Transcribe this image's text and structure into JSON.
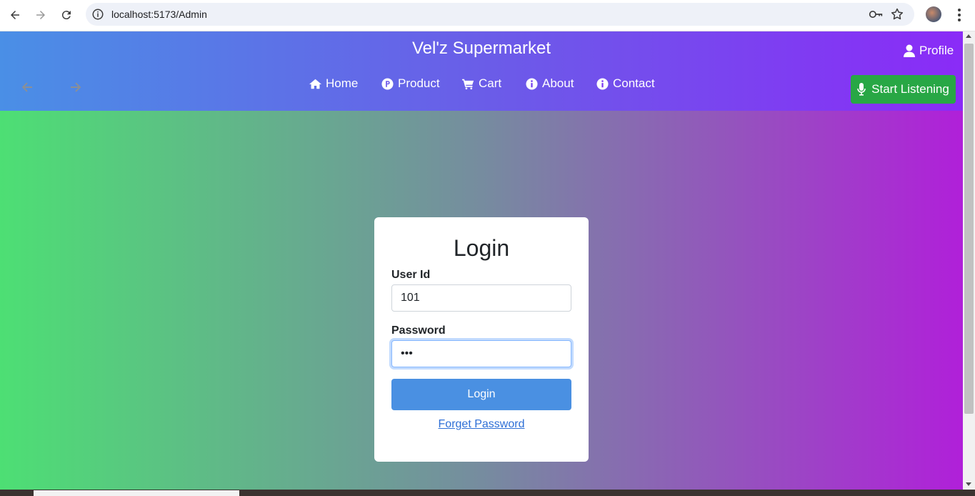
{
  "browser": {
    "url": "localhost:5173/Admin"
  },
  "header": {
    "site_title": "Vel'z Supermarket",
    "profile_label": "Profile",
    "listen_label": "Start Listening",
    "nav": [
      {
        "label": "Home",
        "icon": "home-icon"
      },
      {
        "label": "Product",
        "icon": "product-icon"
      },
      {
        "label": "Cart",
        "icon": "cart-icon"
      },
      {
        "label": "About",
        "icon": "info-icon"
      },
      {
        "label": "Contact",
        "icon": "info-icon"
      }
    ]
  },
  "login": {
    "title": "Login",
    "user_id_label": "User Id",
    "user_id_value": "101",
    "password_label": "Password",
    "password_value": "•••",
    "submit_label": "Login",
    "forgot_label": "Forget Password"
  },
  "colors": {
    "header_gradient": [
      "#4a8fe6",
      "#8a2bf7"
    ],
    "body_gradient": [
      "#4ddf74",
      "#b020d9"
    ],
    "listen_button": "#28a745",
    "login_button": "#4a90e2"
  }
}
